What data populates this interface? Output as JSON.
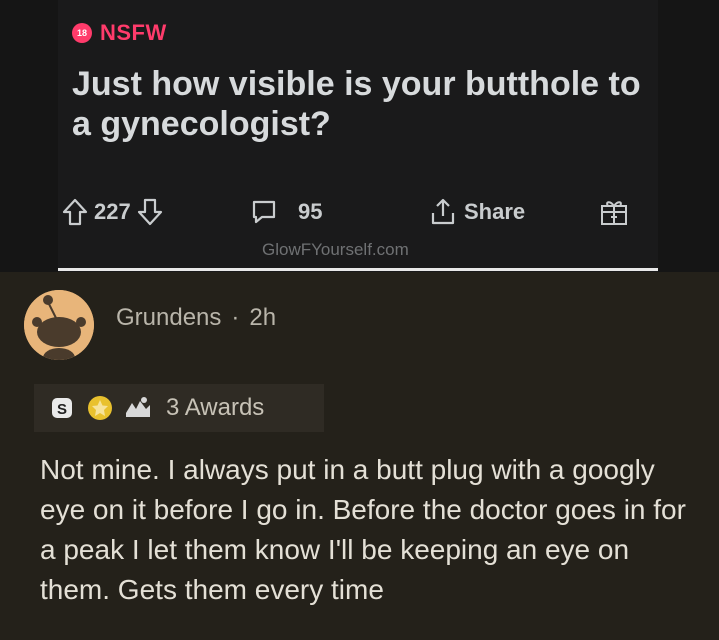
{
  "post": {
    "nsfw_badge": "18",
    "nsfw_label": "NSFW",
    "title": "Just how visible is your butthole to a gynecologist?",
    "actions": {
      "votes": "227",
      "comments": "95",
      "share": "Share"
    },
    "watermark": "GlowFYourself.com"
  },
  "comment": {
    "author": "Grundens",
    "separator": "·",
    "age": "2h",
    "awards_label": "3 Awards",
    "body": "Not mine. I always put in a butt plug with a googly eye on it before I go in. Before the doctor goes in for a peak I let them know I'll be keeping an eye on them. Gets them every time"
  },
  "colors": {
    "nsfw": "#ff3b6b",
    "post_bg": "#1a1a1b",
    "comment_bg": "#24211a",
    "avatar": "#e8b57a"
  },
  "icons": [
    "upvote-icon",
    "downvote-icon",
    "comment-icon",
    "share-icon",
    "award-gift-icon",
    "award-silver-icon",
    "award-gold-icon",
    "award-wholesome-icon"
  ]
}
